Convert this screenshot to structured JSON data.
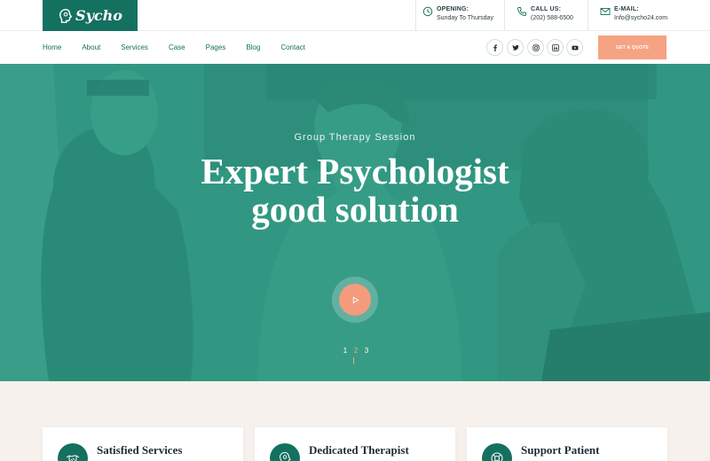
{
  "brand": {
    "name": "Sycho"
  },
  "header_info": [
    {
      "label": "OPENING:",
      "value": "Sunday To Thursday",
      "icon": "clock-icon"
    },
    {
      "label": "CALL US:",
      "value": "(202) 588-6500",
      "icon": "phone-icon"
    },
    {
      "label": "E-MAIL:",
      "value": "Info@sycho24.com",
      "icon": "mail-icon"
    }
  ],
  "nav": {
    "items": [
      "Home",
      "About",
      "Services",
      "Case",
      "Pages",
      "Blog",
      "Contact"
    ]
  },
  "social": [
    "facebook-icon",
    "twitter-icon",
    "instagram-icon",
    "linkedin-icon",
    "youtube-icon"
  ],
  "cta": {
    "label": "GET A QUOTE"
  },
  "hero": {
    "subtitle": "Group Therapy Session",
    "title": "Expert Psychologist good solution",
    "slides": [
      "1",
      "2",
      "3"
    ],
    "active_slide": 2
  },
  "features": [
    {
      "title": "Satisfied Services"
    },
    {
      "title": "Dedicated Therapist"
    },
    {
      "title": "Support Patient"
    }
  ],
  "colors": {
    "brand": "#14705f",
    "accent": "#f6a384",
    "hero_overlay": "#3e9d8a",
    "section_bg": "#f6f1ec"
  }
}
